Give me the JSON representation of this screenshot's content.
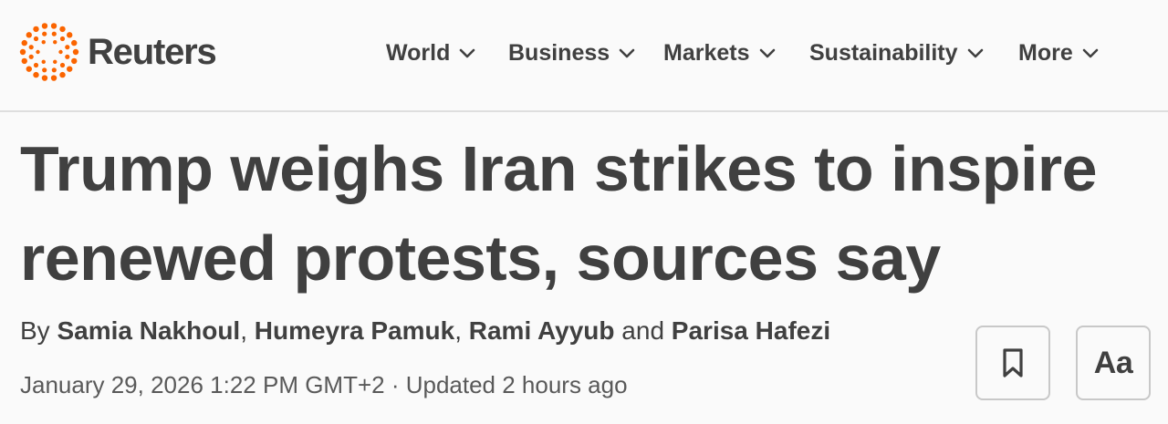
{
  "brand": {
    "name": "Reuters",
    "accent_color": "#fa6400",
    "logo_icon": "reuters-dots-logo-icon"
  },
  "nav": {
    "items": [
      {
        "label": "World",
        "icon": "chevron-down-icon"
      },
      {
        "label": "Business",
        "icon": "chevron-down-icon"
      },
      {
        "label": "Markets",
        "icon": "chevron-down-icon"
      },
      {
        "label": "Sustainability",
        "icon": "chevron-down-icon"
      },
      {
        "label": "More",
        "icon": "chevron-down-icon"
      }
    ]
  },
  "article": {
    "headline_line1": "Trump weighs Iran strikes to inspire",
    "headline_line2": "renewed protests, sources say",
    "byline": {
      "prefix": "By ",
      "authors": [
        "Samia Nakhoul",
        "Humeyra Pamuk",
        "Rami Ayyub",
        "Parisa Hafezi"
      ],
      "separator": ", ",
      "conjunction": " and "
    },
    "dateline": "January 29, 2026 1:22 PM GMT+2 · Updated 2 hours ago"
  },
  "actions": {
    "bookmark_icon": "bookmark-icon",
    "text_size_label": "Aa"
  },
  "colors": {
    "text": "#404040",
    "muted": "#595959",
    "divider": "#dedede",
    "background": "#fafafa"
  }
}
